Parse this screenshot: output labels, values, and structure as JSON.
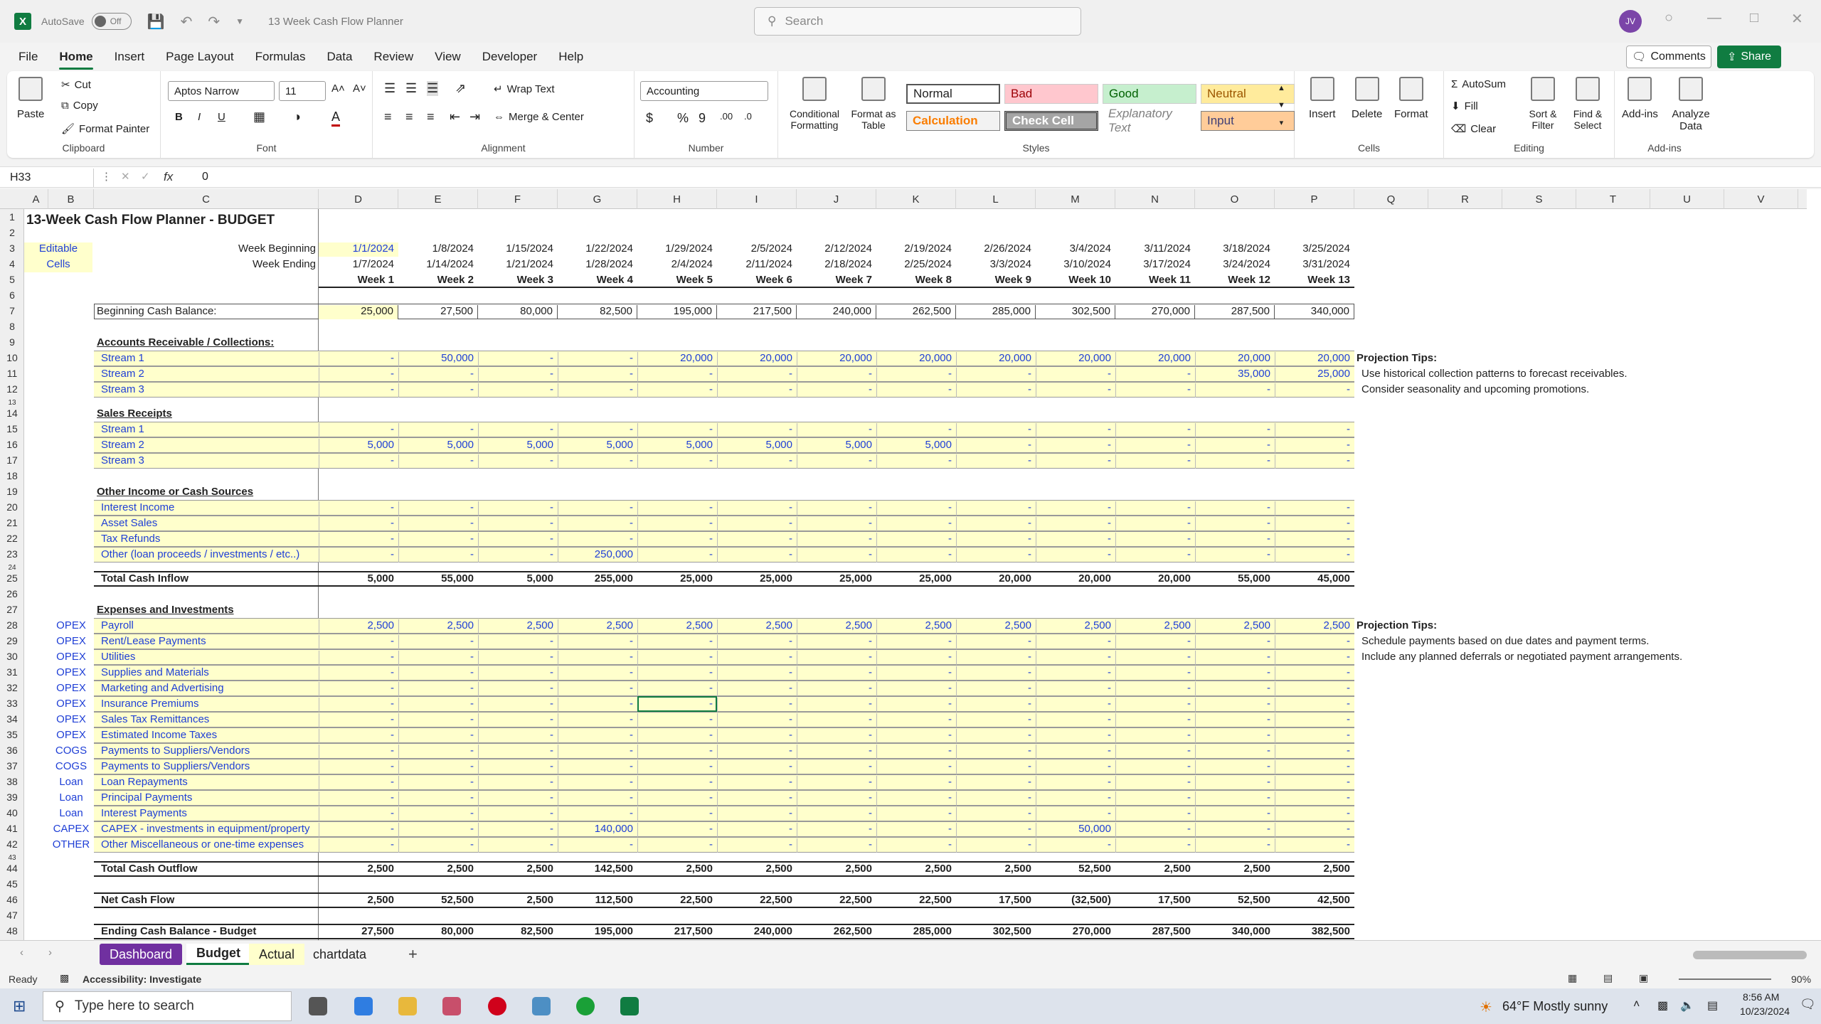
{
  "window": {
    "autosave_label": "AutoSave",
    "autosave_state": "Off",
    "doc_title": "13 Week Cash Flow Planner",
    "search_placeholder": "Search",
    "user_initials": "JV"
  },
  "menu": [
    "File",
    "Home",
    "Insert",
    "Page Layout",
    "Formulas",
    "Data",
    "Review",
    "View",
    "Developer",
    "Help"
  ],
  "menu_active": "Home",
  "actions": {
    "comments": "Comments",
    "share": "Share"
  },
  "ribbon": {
    "clipboard": {
      "paste": "Paste",
      "cut": "Cut",
      "copy": "Copy",
      "format_painter": "Format Painter",
      "label": "Clipboard"
    },
    "font": {
      "name": "Aptos Narrow",
      "size": "11",
      "label": "Font"
    },
    "alignment": {
      "wrap": "Wrap Text",
      "merge": "Merge & Center",
      "label": "Alignment"
    },
    "number": {
      "format": "Accounting",
      "label": "Number"
    },
    "styles": {
      "cond": "Conditional Formatting",
      "table": "Format as Table",
      "normal": "Normal",
      "bad": "Bad",
      "good": "Good",
      "neutral": "Neutral",
      "calculation": "Calculation",
      "check": "Check Cell",
      "explanatory": "Explanatory Text",
      "input": "Input",
      "label": "Styles"
    },
    "cells": {
      "insert": "Insert",
      "delete": "Delete",
      "format": "Format",
      "label": "Cells"
    },
    "editing": {
      "autosum": "AutoSum",
      "fill": "Fill",
      "clear": "Clear",
      "sort": "Sort & Filter",
      "find": "Find & Select",
      "label": "Editing"
    },
    "addins": {
      "addins": "Add-ins",
      "analyze": "Analyze Data",
      "label": "Add-ins"
    }
  },
  "formula_bar": {
    "name_box": "H33",
    "fx": "fx",
    "value": "0"
  },
  "columns": [
    "A",
    "B",
    "C",
    "D",
    "E",
    "F",
    "G",
    "H",
    "I",
    "J",
    "K",
    "L",
    "M",
    "N",
    "O",
    "P",
    "Q",
    "R",
    "S",
    "T",
    "U",
    "V"
  ],
  "sheet": {
    "title": "13-Week Cash Flow Planner - BUDGET",
    "editable_1": "Editable",
    "editable_2": "Cells",
    "week_beginning_label": "Week Beginning",
    "week_ending_label": "Week Ending",
    "week_beginning": [
      "1/1/2024",
      "1/8/2024",
      "1/15/2024",
      "1/22/2024",
      "1/29/2024",
      "2/5/2024",
      "2/12/2024",
      "2/19/2024",
      "2/26/2024",
      "3/4/2024",
      "3/11/2024",
      "3/18/2024",
      "3/25/2024"
    ],
    "week_ending": [
      "1/7/2024",
      "1/14/2024",
      "1/21/2024",
      "1/28/2024",
      "2/4/2024",
      "2/11/2024",
      "2/18/2024",
      "2/25/2024",
      "3/3/2024",
      "3/10/2024",
      "3/17/2024",
      "3/24/2024",
      "3/31/2024"
    ],
    "weeks": [
      "Week 1",
      "Week 2",
      "Week 3",
      "Week 4",
      "Week 5",
      "Week 6",
      "Week 7",
      "Week 8",
      "Week 9",
      "Week 10",
      "Week 11",
      "Week 12",
      "Week 13"
    ],
    "beginning_label": "Beginning Cash Balance:",
    "beginning": [
      "25,000",
      "27,500",
      "80,000",
      "82,500",
      "195,000",
      "217,500",
      "240,000",
      "262,500",
      "285,000",
      "302,500",
      "270,000",
      "287,500",
      "340,000"
    ],
    "ar_header": "Accounts Receivable / Collections:",
    "ar_rows": [
      {
        "label": "Stream 1",
        "values": [
          "-",
          "50,000",
          "-",
          "-",
          "20,000",
          "20,000",
          "20,000",
          "20,000",
          "20,000",
          "20,000",
          "20,000",
          "20,000",
          "20,000"
        ]
      },
      {
        "label": "Stream 2",
        "values": [
          "-",
          "-",
          "-",
          "-",
          "-",
          "-",
          "-",
          "-",
          "-",
          "-",
          "-",
          "35,000",
          "25,000"
        ]
      },
      {
        "label": "Stream 3",
        "values": [
          "-",
          "-",
          "-",
          "-",
          "-",
          "-",
          "-",
          "-",
          "-",
          "-",
          "-",
          "-",
          "-"
        ]
      }
    ],
    "sales_header": "Sales Receipts",
    "sales_rows": [
      {
        "label": "Stream 1",
        "values": [
          "-",
          "-",
          "-",
          "-",
          "-",
          "-",
          "-",
          "-",
          "-",
          "-",
          "-",
          "-",
          "-"
        ]
      },
      {
        "label": "Stream 2",
        "values": [
          "5,000",
          "5,000",
          "5,000",
          "5,000",
          "5,000",
          "5,000",
          "5,000",
          "5,000",
          "-",
          "-",
          "-",
          "-",
          "-"
        ]
      },
      {
        "label": "Stream 3",
        "values": [
          "-",
          "-",
          "-",
          "-",
          "-",
          "-",
          "-",
          "-",
          "-",
          "-",
          "-",
          "-",
          "-"
        ]
      }
    ],
    "other_header": "Other Income or Cash Sources",
    "other_rows": [
      {
        "label": "Interest Income",
        "values": [
          "-",
          "-",
          "-",
          "-",
          "-",
          "-",
          "-",
          "-",
          "-",
          "-",
          "-",
          "-",
          "-"
        ]
      },
      {
        "label": "Asset Sales",
        "values": [
          "-",
          "-",
          "-",
          "-",
          "-",
          "-",
          "-",
          "-",
          "-",
          "-",
          "-",
          "-",
          "-"
        ]
      },
      {
        "label": "Tax Refunds",
        "values": [
          "-",
          "-",
          "-",
          "-",
          "-",
          "-",
          "-",
          "-",
          "-",
          "-",
          "-",
          "-",
          "-"
        ]
      },
      {
        "label": "Other (loan proceeds / investments / etc..)",
        "values": [
          "-",
          "-",
          "-",
          "250,000",
          "-",
          "-",
          "-",
          "-",
          "-",
          "-",
          "-",
          "-",
          "-"
        ]
      }
    ],
    "inflow_label": "Total Cash Inflow",
    "inflow": [
      "5,000",
      "55,000",
      "5,000",
      "255,000",
      "25,000",
      "25,000",
      "25,000",
      "25,000",
      "20,000",
      "20,000",
      "20,000",
      "55,000",
      "45,000"
    ],
    "exp_header": "Expenses and Investments",
    "exp_rows": [
      {
        "cat": "OPEX",
        "label": "Payroll",
        "values": [
          "2,500",
          "2,500",
          "2,500",
          "2,500",
          "2,500",
          "2,500",
          "2,500",
          "2,500",
          "2,500",
          "2,500",
          "2,500",
          "2,500",
          "2,500"
        ]
      },
      {
        "cat": "OPEX",
        "label": "Rent/Lease Payments",
        "values": [
          "-",
          "-",
          "-",
          "-",
          "-",
          "-",
          "-",
          "-",
          "-",
          "-",
          "-",
          "-",
          "-"
        ]
      },
      {
        "cat": "OPEX",
        "label": "Utilities",
        "values": [
          "-",
          "-",
          "-",
          "-",
          "-",
          "-",
          "-",
          "-",
          "-",
          "-",
          "-",
          "-",
          "-"
        ]
      },
      {
        "cat": "OPEX",
        "label": "Supplies and Materials",
        "values": [
          "-",
          "-",
          "-",
          "-",
          "-",
          "-",
          "-",
          "-",
          "-",
          "-",
          "-",
          "-",
          "-"
        ]
      },
      {
        "cat": "OPEX",
        "label": "Marketing and Advertising",
        "values": [
          "-",
          "-",
          "-",
          "-",
          "-",
          "-",
          "-",
          "-",
          "-",
          "-",
          "-",
          "-",
          "-"
        ]
      },
      {
        "cat": "OPEX",
        "label": "Insurance  Premiums",
        "values": [
          "-",
          "-",
          "-",
          "-",
          "-",
          "-",
          "-",
          "-",
          "-",
          "-",
          "-",
          "-",
          "-"
        ]
      },
      {
        "cat": "OPEX",
        "label": "Sales Tax Remittances",
        "values": [
          "-",
          "-",
          "-",
          "-",
          "-",
          "-",
          "-",
          "-",
          "-",
          "-",
          "-",
          "-",
          "-"
        ]
      },
      {
        "cat": "OPEX",
        "label": "Estimated Income Taxes",
        "values": [
          "-",
          "-",
          "-",
          "-",
          "-",
          "-",
          "-",
          "-",
          "-",
          "-",
          "-",
          "-",
          "-"
        ]
      },
      {
        "cat": "COGS",
        "label": "Payments to Suppliers/Vendors",
        "values": [
          "-",
          "-",
          "-",
          "-",
          "-",
          "-",
          "-",
          "-",
          "-",
          "-",
          "-",
          "-",
          "-"
        ]
      },
      {
        "cat": "COGS",
        "label": "Payments to Suppliers/Vendors",
        "values": [
          "-",
          "-",
          "-",
          "-",
          "-",
          "-",
          "-",
          "-",
          "-",
          "-",
          "-",
          "-",
          "-"
        ]
      },
      {
        "cat": "Loan",
        "label": "Loan Repayments",
        "values": [
          "-",
          "-",
          "-",
          "-",
          "-",
          "-",
          "-",
          "-",
          "-",
          "-",
          "-",
          "-",
          "-"
        ]
      },
      {
        "cat": "Loan",
        "label": "Principal Payments",
        "values": [
          "-",
          "-",
          "-",
          "-",
          "-",
          "-",
          "-",
          "-",
          "-",
          "-",
          "-",
          "-",
          "-"
        ]
      },
      {
        "cat": "Loan",
        "label": "Interest Payments",
        "values": [
          "-",
          "-",
          "-",
          "-",
          "-",
          "-",
          "-",
          "-",
          "-",
          "-",
          "-",
          "-",
          "-"
        ]
      },
      {
        "cat": "CAPEX",
        "label": "CAPEX - investments in equipment/property",
        "values": [
          "-",
          "-",
          "-",
          "140,000",
          "-",
          "-",
          "-",
          "-",
          "-",
          "50,000",
          "-",
          "-",
          "-"
        ]
      },
      {
        "cat": "OTHER",
        "label": "Other Miscellaneous or one-time expenses",
        "values": [
          "-",
          "-",
          "-",
          "-",
          "-",
          "-",
          "-",
          "-",
          "-",
          "-",
          "-",
          "-",
          "-"
        ]
      }
    ],
    "outflow_label": "Total Cash Outflow",
    "outflow": [
      "2,500",
      "2,500",
      "2,500",
      "142,500",
      "2,500",
      "2,500",
      "2,500",
      "2,500",
      "2,500",
      "52,500",
      "2,500",
      "2,500",
      "2,500"
    ],
    "net_label": "Net Cash Flow",
    "net": [
      "2,500",
      "52,500",
      "2,500",
      "112,500",
      "22,500",
      "22,500",
      "22,500",
      "22,500",
      "17,500",
      "(32,500)",
      "17,500",
      "52,500",
      "42,500"
    ],
    "ending_label": "Ending Cash Balance - Budget",
    "ending": [
      "27,500",
      "80,000",
      "82,500",
      "195,000",
      "217,500",
      "240,000",
      "262,500",
      "285,000",
      "302,500",
      "270,000",
      "287,500",
      "340,000",
      "382,500"
    ],
    "tips1_title": "Projection Tips:",
    "tips1": [
      "Use historical collection patterns to forecast receivables.",
      "Consider seasonality and upcoming promotions."
    ],
    "tips2_title": "Projection Tips:",
    "tips2": [
      "Schedule payments based on due dates and payment terms.",
      "Include any planned deferrals or negotiated payment arrangements."
    ]
  },
  "tabs": [
    "Dashboard",
    "Budget",
    "Actual",
    "chartdata"
  ],
  "active_tab": "Budget",
  "status": {
    "ready": "Ready",
    "accessibility": "Accessibility: Investigate",
    "zoom": "90%"
  },
  "taskbar": {
    "search": "Type here to search",
    "weather": "64°F  Mostly sunny",
    "time": "8:56 AM",
    "date": "10/23/2024"
  }
}
